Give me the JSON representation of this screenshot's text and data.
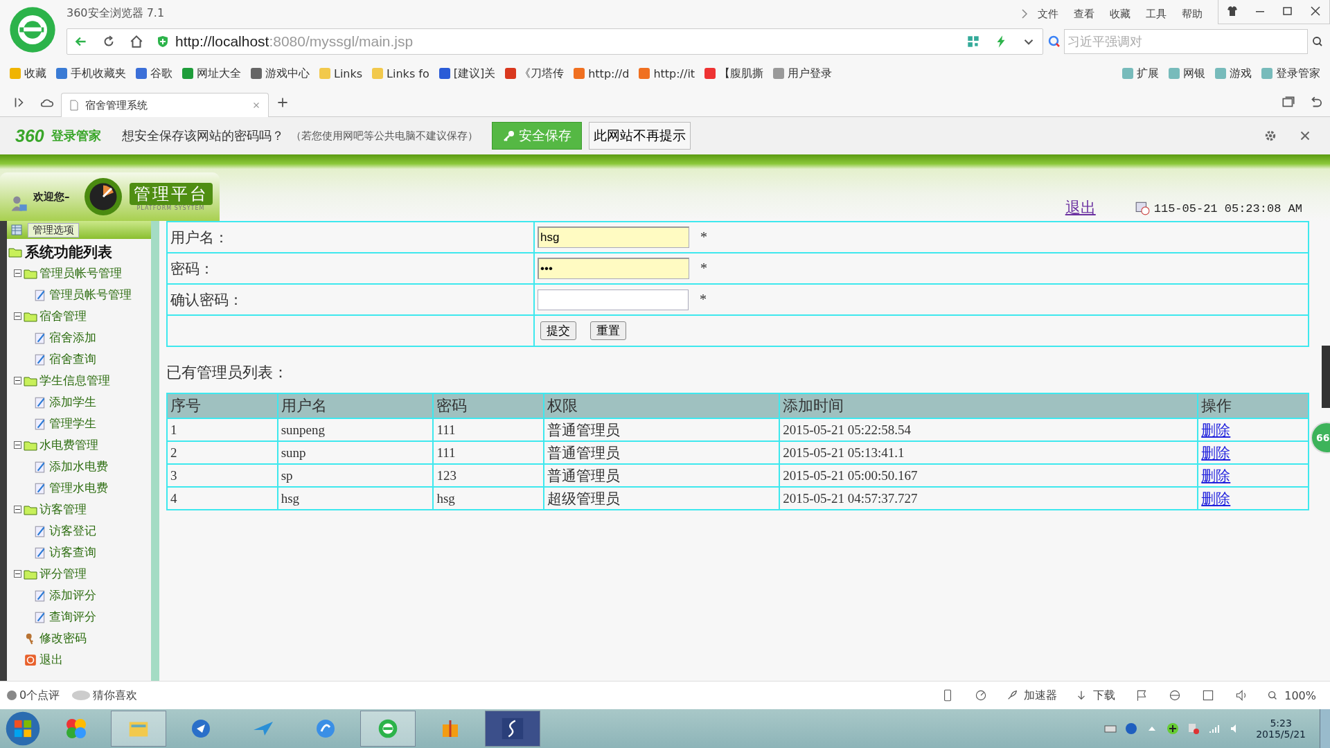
{
  "window": {
    "title": "360安全浏览器 7.1",
    "menu": [
      "文件",
      "查看",
      "收藏",
      "工具",
      "帮助"
    ]
  },
  "address_bar": {
    "url_host": "http://localhost",
    "url_rest": ":8080/myssgl/main.jsp",
    "search_placeholder": "习近平强调对"
  },
  "bookmarks": [
    {
      "label": "收藏",
      "kind": "star"
    },
    {
      "label": "手机收藏夹",
      "kind": "phone"
    },
    {
      "label": "谷歌",
      "kind": "g"
    },
    {
      "label": "网址大全",
      "kind": "plus"
    },
    {
      "label": "游戏中心",
      "kind": "game"
    },
    {
      "label": "Links",
      "kind": "folder"
    },
    {
      "label": "Links fo",
      "kind": "folder"
    },
    {
      "label": "[建议]关",
      "kind": "paw"
    },
    {
      "label": "《刀塔传",
      "kind": "l"
    },
    {
      "label": "http://d",
      "kind": "tao"
    },
    {
      "label": "http://it",
      "kind": "tao"
    },
    {
      "label": "【腹肌撕",
      "kind": "number"
    },
    {
      "label": "用户登录",
      "kind": "page"
    }
  ],
  "bookmark_tools": [
    "扩展",
    "网银",
    "游戏",
    "登录管家"
  ],
  "tabs": [
    {
      "label": "宿舍管理系统",
      "selected": true
    }
  ],
  "password_bar": {
    "brand": "360",
    "brand_label": "登录管家",
    "question": "想安全保存该网站的密码吗？",
    "hint": "（若您使用网吧等公共电脑不建议保存）",
    "save_button": "安全保存",
    "never_button": "此网站不再提示"
  },
  "header": {
    "welcome": "欢迎您–",
    "logo_title": "管理平台",
    "logo_subtitle": "PLATFORM SYSYTEM",
    "logout": "退出",
    "datetime": "115-05-21 05:23:08 AM"
  },
  "sidebar": {
    "tab": "管理选项",
    "root": "系统功能列表",
    "items": [
      {
        "label": "管理员帐号管理",
        "kind": "folder",
        "children": [
          {
            "label": "管理员帐号管理",
            "kind": "page"
          }
        ]
      },
      {
        "label": "宿舍管理",
        "kind": "folder",
        "children": [
          {
            "label": "宿舍添加",
            "kind": "page"
          },
          {
            "label": "宿舍查询",
            "kind": "page"
          }
        ]
      },
      {
        "label": "学生信息管理",
        "kind": "folder",
        "children": [
          {
            "label": "添加学生",
            "kind": "page"
          },
          {
            "label": "管理学生",
            "kind": "page"
          }
        ]
      },
      {
        "label": "水电费管理",
        "kind": "folder",
        "children": [
          {
            "label": "添加水电费",
            "kind": "page"
          },
          {
            "label": "管理水电费",
            "kind": "page"
          }
        ]
      },
      {
        "label": "访客管理",
        "kind": "folder",
        "children": [
          {
            "label": "访客登记",
            "kind": "page"
          },
          {
            "label": "访客查询",
            "kind": "page"
          }
        ]
      },
      {
        "label": "评分管理",
        "kind": "folder",
        "children": [
          {
            "label": "添加评分",
            "kind": "page"
          },
          {
            "label": "查询评分",
            "kind": "page"
          }
        ]
      },
      {
        "label": "修改密码",
        "kind": "key"
      },
      {
        "label": "退出",
        "kind": "exit"
      }
    ]
  },
  "form": {
    "fields": [
      {
        "label": "用户名：",
        "value": "hsg",
        "autofilled": true,
        "required": "*"
      },
      {
        "label": "密码：",
        "value": "•••",
        "autofilled": true,
        "required": "*"
      },
      {
        "label": "确认密码：",
        "autofilled": false,
        "required": "*"
      }
    ],
    "buttons": [
      "提交",
      "重置"
    ]
  },
  "list_title": "已有管理员列表：",
  "table": {
    "columns": [
      "序号",
      "用户名",
      "密码",
      "权限",
      "添加时间",
      "操作"
    ],
    "rows": [
      [
        "1",
        "sunpeng",
        "111",
        "普通管理员",
        "2015-05-21 05:22:58.54",
        "删除"
      ],
      [
        "2",
        "sunp",
        "111",
        "普通管理员",
        "2015-05-21 05:13:41.1",
        "删除"
      ],
      [
        "3",
        "sp",
        "123",
        "普通管理员",
        "2015-05-21 05:00:50.167",
        "删除"
      ],
      [
        "4",
        "hsg",
        "hsg",
        "超级管理员",
        "2015-05-21 04:57:37.727",
        "删除"
      ]
    ]
  },
  "side_badge": "66",
  "status_bar": {
    "left": [
      "0个点评",
      "猜你喜欢"
    ],
    "right": [
      "加速器",
      "下载"
    ],
    "zoom": "100%"
  },
  "taskbar": {
    "time": "5:23",
    "date": "2015/5/21"
  }
}
